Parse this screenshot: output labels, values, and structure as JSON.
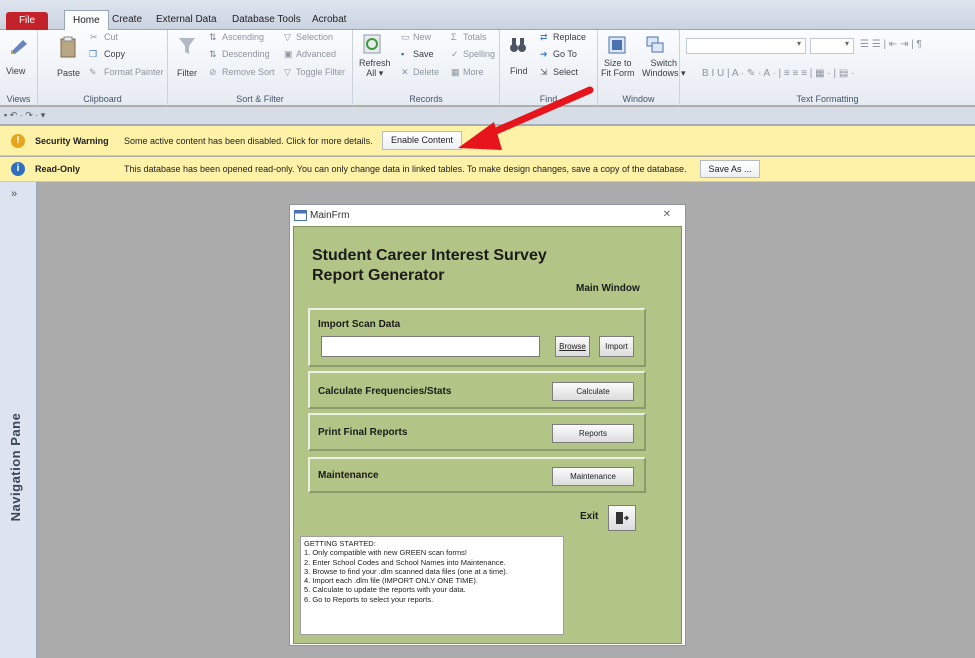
{
  "tabs": {
    "file": "File",
    "home": "Home",
    "create": "Create",
    "external": "External Data",
    "dbtools": "Database Tools",
    "acrobat": "Acrobat"
  },
  "ribbon": {
    "views": {
      "label": "Views",
      "view": "View"
    },
    "clipboard": {
      "label": "Clipboard",
      "paste": "Paste",
      "cut": "Cut",
      "copy": "Copy",
      "format_painter": "Format Painter"
    },
    "sortfilter": {
      "label": "Sort & Filter",
      "filter": "Filter",
      "ascending": "Ascending",
      "descending": "Descending",
      "remove_sort": "Remove Sort",
      "selection": "Selection",
      "advanced": "Advanced",
      "toggle_filter": "Toggle Filter"
    },
    "records": {
      "label": "Records",
      "refresh": "Refresh",
      "all": "All",
      "new": "New",
      "save": "Save",
      "delete": "Delete",
      "totals": "Totals",
      "spelling": "Spelling",
      "more": "More"
    },
    "find": {
      "label": "Find",
      "find": "Find",
      "replace": "Replace",
      "goto": "Go To",
      "select": "Select"
    },
    "window": {
      "label": "Window",
      "size_to": "Size to",
      "fit_form": "Fit Form",
      "switch": "Switch",
      "windows": "Windows"
    },
    "textformat": {
      "label": "Text Formatting"
    }
  },
  "security_bar": {
    "title": "Security Warning",
    "message": "Some active content has been disabled. Click for more details.",
    "button": "Enable Content"
  },
  "readonly_bar": {
    "title": "Read-Only",
    "message": "This database has been opened read-only. You can only change data in linked tables. To make design changes, save a copy of the database.",
    "button": "Save As ..."
  },
  "nav": {
    "label": "Navigation Pane",
    "chevron": "»"
  },
  "form": {
    "window_title": "MainFrm",
    "heading_line1": "Student Career Interest Survey",
    "heading_line2": "Report Generator",
    "main_window": "Main Window",
    "import": {
      "label": "Import Scan Data",
      "browse": "Browse",
      "import": "Import",
      "field_value": ""
    },
    "calculate": {
      "label": "Calculate Frequencies/Stats",
      "button": "Calculate"
    },
    "reports": {
      "label": "Print Final Reports",
      "button": "Reports"
    },
    "maintenance": {
      "label": "Maintenance",
      "button": "Maintenance"
    },
    "exit": "Exit",
    "getting_started": [
      "GETTING STARTED:",
      "1.  Only compatible with new GREEN scan forms!",
      "2.  Enter School Codes and School Names into Maintenance.",
      "3.  Browse to find your .dlm scanned data files (one at a time).",
      "4.  Import each .dlm file (IMPORT ONLY ONE TIME).",
      "5.  Calculate to update the reports with your data.",
      "6.  Go to Reports to select your reports."
    ]
  },
  "colors": {
    "security_bar": "#fdf2a8",
    "form_bg": "#b3c586",
    "file_tab": "#c4222a",
    "arrow": "#e8141b"
  }
}
